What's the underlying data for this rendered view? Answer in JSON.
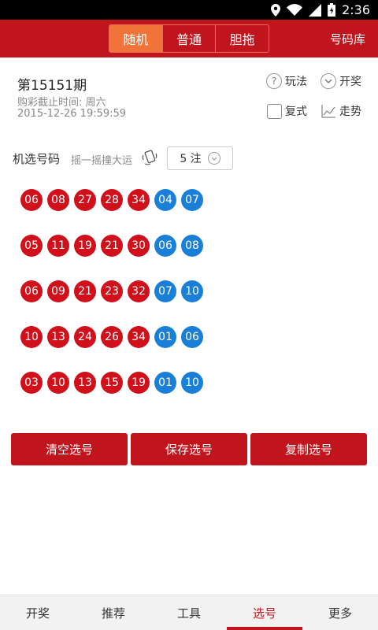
{
  "status_bar": {
    "time": "2:36"
  },
  "header": {
    "tabs": [
      {
        "label": "随机",
        "active": true
      },
      {
        "label": "普通",
        "active": false
      },
      {
        "label": "胆拖",
        "active": false
      }
    ],
    "library_link": "号码库"
  },
  "issue": {
    "title": "第15151期",
    "deadline_label": "购彩截止时间: 周六",
    "deadline_time": "2015-12-26 19:59:59"
  },
  "options": {
    "rules": "玩法",
    "draw": "开奖",
    "compound": "复式",
    "trend": "走势"
  },
  "picker": {
    "title": "机选号码",
    "shake_hint": "摇一摇撞大运",
    "count": "5 注"
  },
  "colors": {
    "red": "#d0101b",
    "blue": "#1a7fd6",
    "brand": "#c0151d"
  },
  "tickets": [
    {
      "red": [
        "06",
        "08",
        "27",
        "28",
        "34"
      ],
      "blue": [
        "04",
        "07"
      ]
    },
    {
      "red": [
        "05",
        "11",
        "19",
        "21",
        "30"
      ],
      "blue": [
        "06",
        "08"
      ]
    },
    {
      "red": [
        "06",
        "09",
        "21",
        "23",
        "32"
      ],
      "blue": [
        "07",
        "10"
      ]
    },
    {
      "red": [
        "10",
        "13",
        "24",
        "26",
        "34"
      ],
      "blue": [
        "01",
        "06"
      ]
    },
    {
      "red": [
        "03",
        "10",
        "13",
        "15",
        "19"
      ],
      "blue": [
        "01",
        "10"
      ]
    }
  ],
  "actions": {
    "clear": "清空选号",
    "save": "保存选号",
    "copy": "复制选号"
  },
  "tabbar": [
    {
      "label": "开奖",
      "active": false
    },
    {
      "label": "推荐",
      "active": false
    },
    {
      "label": "工具",
      "active": false
    },
    {
      "label": "选号",
      "active": true
    },
    {
      "label": "更多",
      "active": false
    }
  ]
}
